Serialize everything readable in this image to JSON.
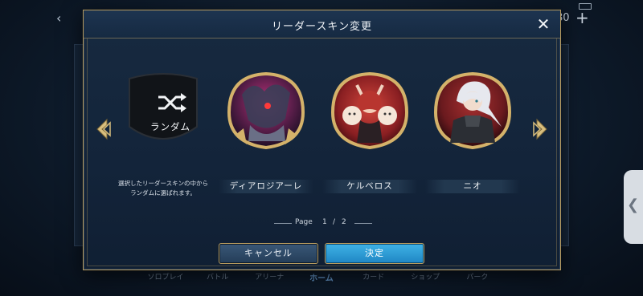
{
  "background": {
    "count_text": "80",
    "nav_items": [
      "ソロプレイ",
      "バトル",
      "アリーナ",
      "ホーム",
      "カード",
      "ショップ",
      "パーク"
    ]
  },
  "modal": {
    "title": "リーダースキン変更",
    "close_icon": "close-icon",
    "random": {
      "label": "ランダム",
      "icon": "shuffle-icon",
      "description_line1": "選択したリーダースキンの中から",
      "description_line2": "ランダムに選ばれます。"
    },
    "skins": [
      {
        "name": "ディアロジアーレ"
      },
      {
        "name": "ケルベロス"
      },
      {
        "name": "ニオ"
      }
    ],
    "pager": {
      "word": "Page",
      "current": "1",
      "separator": "/",
      "total": "2"
    },
    "buttons": {
      "cancel": "キャンセル",
      "ok": "決定"
    }
  },
  "colors": {
    "gold_frame": "#b69a5e",
    "panel_bg": "#13243a",
    "ok_button": "#2a9bd6",
    "cancel_button": "#2e4a68"
  }
}
